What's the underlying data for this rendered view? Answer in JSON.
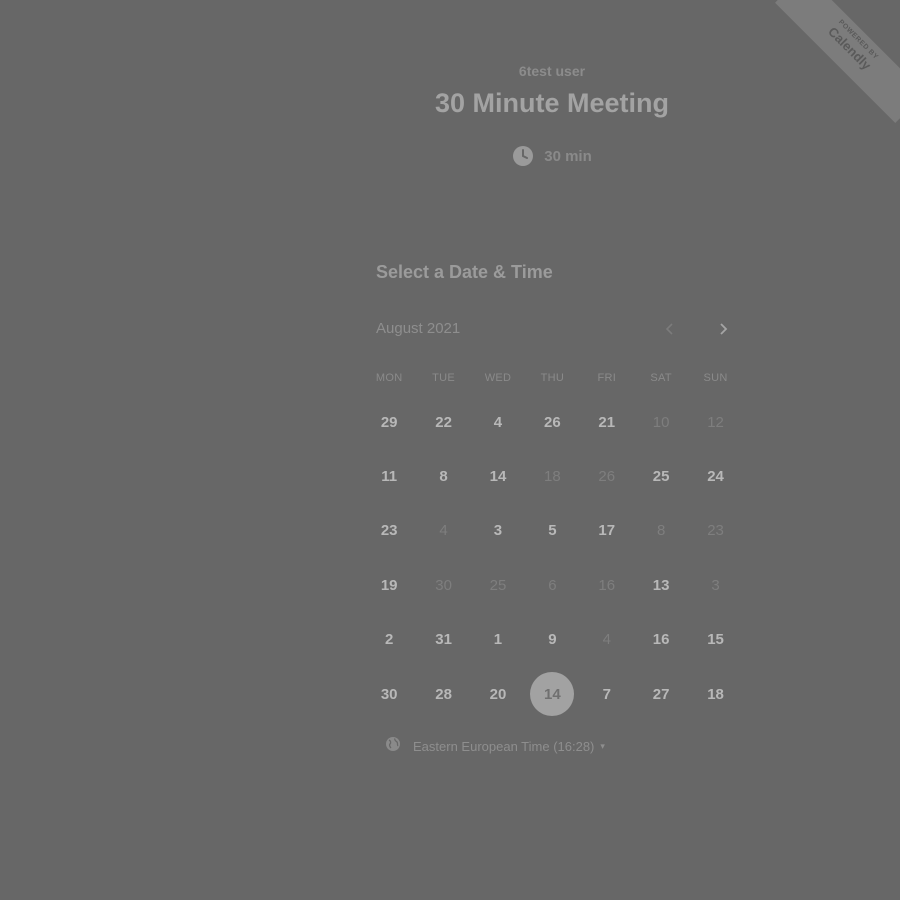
{
  "ribbon": {
    "small": "POWERED BY",
    "brand": "Calendly"
  },
  "event": {
    "owner": "6test user",
    "title": "30 Minute Meeting",
    "duration": "30 min",
    "duration_icon": "clock-icon"
  },
  "picker": {
    "title": "Select a Date & Time",
    "month": "August 2021",
    "prev_icon": "chevron-left-icon",
    "next_icon": "chevron-right-icon",
    "weekdays": [
      "MON",
      "TUE",
      "WED",
      "THU",
      "FRI",
      "SAT",
      "SUN"
    ],
    "weeks": [
      [
        {
          "d": "29",
          "s": "available"
        },
        {
          "d": "22",
          "s": "available"
        },
        {
          "d": "4",
          "s": "available"
        },
        {
          "d": "26",
          "s": "available"
        },
        {
          "d": "21",
          "s": "available"
        },
        {
          "d": "10",
          "s": "unavailable"
        },
        {
          "d": "12",
          "s": "unavailable"
        }
      ],
      [
        {
          "d": "11",
          "s": "available"
        },
        {
          "d": "8",
          "s": "available"
        },
        {
          "d": "14",
          "s": "available"
        },
        {
          "d": "18",
          "s": "unavailable"
        },
        {
          "d": "26",
          "s": "unavailable"
        },
        {
          "d": "25",
          "s": "available"
        },
        {
          "d": "24",
          "s": "available"
        }
      ],
      [
        {
          "d": "23",
          "s": "available"
        },
        {
          "d": "4",
          "s": "unavailable"
        },
        {
          "d": "3",
          "s": "available"
        },
        {
          "d": "5",
          "s": "available"
        },
        {
          "d": "17",
          "s": "available"
        },
        {
          "d": "8",
          "s": "unavailable"
        },
        {
          "d": "23",
          "s": "unavailable"
        }
      ],
      [
        {
          "d": "19",
          "s": "available"
        },
        {
          "d": "30",
          "s": "unavailable"
        },
        {
          "d": "25",
          "s": "unavailable"
        },
        {
          "d": "6",
          "s": "unavailable"
        },
        {
          "d": "16",
          "s": "unavailable"
        },
        {
          "d": "13",
          "s": "available"
        },
        {
          "d": "3",
          "s": "unavailable"
        }
      ],
      [
        {
          "d": "2",
          "s": "available"
        },
        {
          "d": "31",
          "s": "available"
        },
        {
          "d": "1",
          "s": "available"
        },
        {
          "d": "9",
          "s": "available"
        },
        {
          "d": "4",
          "s": "unavailable"
        },
        {
          "d": "16",
          "s": "available"
        },
        {
          "d": "15",
          "s": "available"
        }
      ],
      [
        {
          "d": "30",
          "s": "available"
        },
        {
          "d": "28",
          "s": "available"
        },
        {
          "d": "20",
          "s": "available"
        },
        {
          "d": "14",
          "s": "selected"
        },
        {
          "d": "7",
          "s": "available"
        },
        {
          "d": "27",
          "s": "available"
        },
        {
          "d": "18",
          "s": "available"
        }
      ]
    ]
  },
  "timezone": {
    "label": "Eastern European Time (16:28)",
    "icon": "globe-icon",
    "caret": "▾"
  },
  "colors": {
    "background": "#676767",
    "selected_day": "#a2a2a2"
  }
}
